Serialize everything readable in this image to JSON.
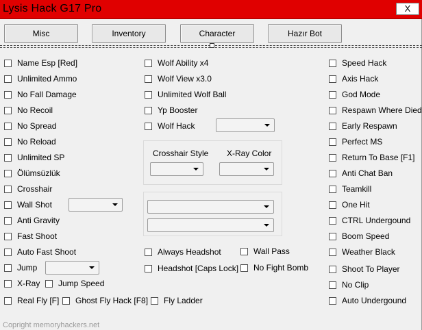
{
  "window": {
    "title": "Lysis Hack G17 Pro",
    "close_label": "X"
  },
  "tabs": [
    "Misc",
    "Inventory",
    "Character",
    "Hazır Bot"
  ],
  "col1": [
    "Name Esp [Red]",
    "Unlimited Ammo",
    "No Fall Damage",
    "No Recoil",
    "No Spread",
    "No Reload",
    "Unlimited SP",
    "Ölümsüzlük",
    "Crosshair",
    "Wall Shot",
    "Anti Gravity",
    "Fast Shoot",
    "Auto Fast Shoot",
    "Jump",
    "X-Ray"
  ],
  "jump_speed": "Jump Speed",
  "bottom_row": [
    "Real Fly [F]",
    "Ghost Fly Hack [F8]",
    "Fly Ladder"
  ],
  "col2": [
    "Wolf Ability x4",
    "Wolf View x3.0",
    "Unlimited Wolf Ball",
    "Yp Booster",
    "Wolf Hack"
  ],
  "crosshair_group": {
    "crosshair_style": "Crosshair Style",
    "xray_color": "X-Ray Color"
  },
  "headshot_options": [
    "Always Headshot",
    "Headshot [Caps Lock]"
  ],
  "misc_options": [
    "Wall Pass",
    "No Fight Bomb"
  ],
  "col3": [
    "Speed Hack",
    "Axis Hack",
    "God Mode",
    "Respawn Where Died",
    "Early Respawn",
    "Perfect MS",
    "Return To Base [F1]",
    "Anti Chat Ban",
    "Teamkill",
    "One Hit",
    "CTRL Undergound",
    "Boom Speed",
    "Weather Black",
    "Shoot To Player",
    "No Clip",
    "Auto Undergound"
  ],
  "footer": "Copright memoryhackers.net",
  "colors": {
    "titlebar": "#e00000",
    "background": "#f0f0f0"
  }
}
